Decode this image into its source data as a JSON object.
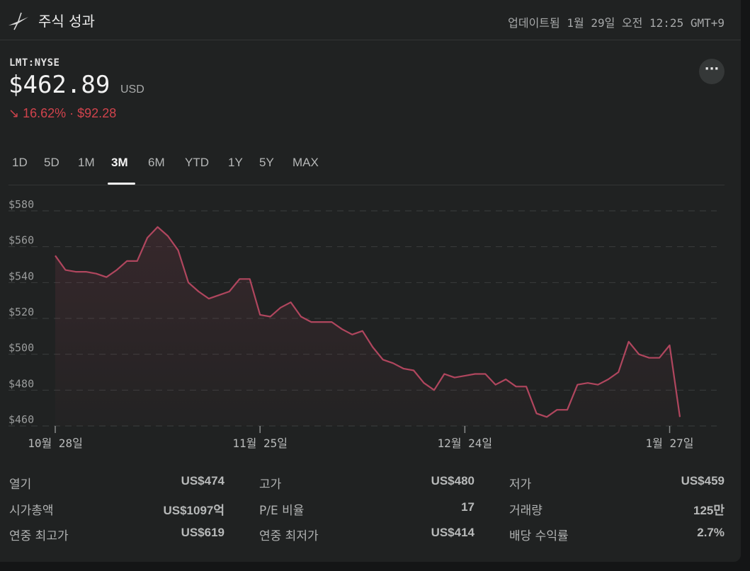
{
  "header": {
    "title": "주식 성과",
    "updated": "업데이트됨 1월 29일 오전 12:25 GMT+9"
  },
  "quote": {
    "ticker": "LMT:NYSE",
    "price": "$462.89",
    "currency": "USD",
    "change_arrow": "↘",
    "change": "16.62% · $92.28",
    "more_label": "···"
  },
  "tabs": [
    {
      "label": "1D"
    },
    {
      "label": "5D"
    },
    {
      "label": "1M"
    },
    {
      "label": "3M",
      "active": true
    },
    {
      "label": "6M"
    },
    {
      "label": "YTD"
    },
    {
      "label": "1Y"
    },
    {
      "label": "5Y"
    },
    {
      "label": "MAX"
    }
  ],
  "stats": [
    [
      {
        "label": "열기",
        "value": "US$474"
      },
      {
        "label": "고가",
        "value": "US$480"
      },
      {
        "label": "저가",
        "value": "US$459"
      }
    ],
    [
      {
        "label": "시가총액",
        "value": "US$1097억"
      },
      {
        "label": "P/E 비율",
        "value": "17"
      },
      {
        "label": "거래량",
        "value": "125만"
      }
    ],
    [
      {
        "label": "연중 최고가",
        "value": "US$619"
      },
      {
        "label": "연중 최저가",
        "value": "US$414"
      },
      {
        "label": "배당 수익률",
        "value": "2.7%"
      }
    ]
  ],
  "chart_data": {
    "type": "line",
    "color": "#b0465e",
    "ylim": [
      460,
      580
    ],
    "yticks": [
      {
        "value": 580,
        "label": "$580"
      },
      {
        "value": 560,
        "label": "$560"
      },
      {
        "value": 540,
        "label": "$540"
      },
      {
        "value": 520,
        "label": "$520"
      },
      {
        "value": 500,
        "label": "$500"
      },
      {
        "value": 480,
        "label": "$480"
      },
      {
        "value": 460,
        "label": "$460"
      }
    ],
    "xticks": [
      {
        "index": 0,
        "label": "10월 28일"
      },
      {
        "index": 20,
        "label": "11월 25일"
      },
      {
        "index": 40,
        "label": "12월 24일"
      },
      {
        "index": 60,
        "label": "1월 27일"
      }
    ],
    "values": [
      555,
      547,
      546,
      546,
      545,
      543,
      547,
      552,
      552,
      565,
      571,
      566,
      558,
      540,
      535,
      531,
      533,
      535,
      542,
      542,
      522,
      521,
      526,
      529,
      521,
      518,
      518,
      518,
      514,
      511,
      513,
      504,
      497,
      495,
      492,
      491,
      484,
      480,
      489,
      487,
      488,
      489,
      489,
      483,
      486,
      482,
      482,
      467,
      465,
      469,
      469,
      483,
      484,
      483,
      486,
      490,
      507,
      500,
      498,
      498,
      505,
      465
    ]
  }
}
